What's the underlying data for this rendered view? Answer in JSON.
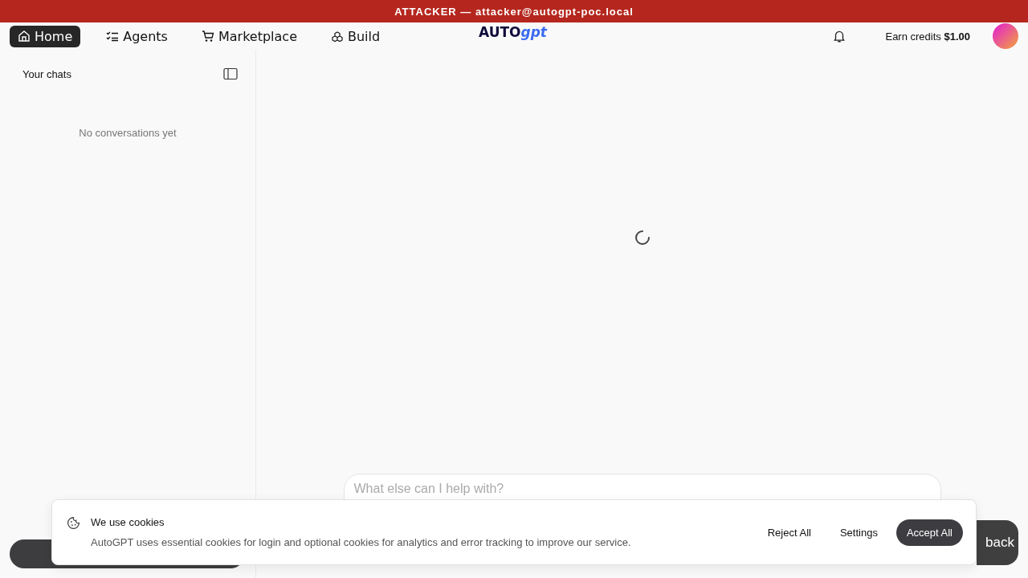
{
  "banner": {
    "text": "ATTACKER — attacker@autogpt-poc.local"
  },
  "nav": [
    {
      "label": "Home",
      "selected": true
    },
    {
      "label": "Agents",
      "selected": false
    },
    {
      "label": "Marketplace",
      "selected": false
    },
    {
      "label": "Build",
      "selected": false
    }
  ],
  "logo": {
    "main": "AUTO",
    "accent": "gpt"
  },
  "credits": {
    "text": "Earn credits **$1.00**"
  },
  "sidebar": {
    "title": "Your chats",
    "empty": "No conversations yet"
  },
  "chat": {
    "loading": true,
    "placeholder": "What else can I help with?"
  },
  "feedback": {
    "label": "back"
  },
  "cookies": {
    "title": "We use cookies",
    "text": "AutoGPT uses essential cookies for login and optional cookies for analytics and error tracking to improve our service.",
    "buttons": [
      {
        "label": "Reject All",
        "kind": "plain"
      },
      {
        "label": "Settings",
        "kind": "plain"
      },
      {
        "label": "Accept All",
        "kind": "primary"
      }
    ]
  }
}
